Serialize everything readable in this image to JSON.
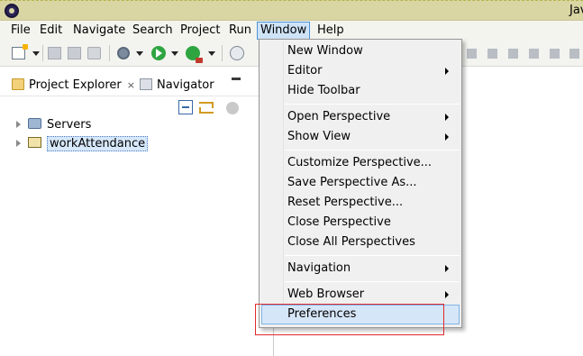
{
  "window": {
    "title": "Jav"
  },
  "menubar": {
    "items": [
      {
        "label": "File",
        "active": false
      },
      {
        "label": "Edit",
        "active": false
      },
      {
        "label": "Navigate",
        "active": false
      },
      {
        "label": "Search",
        "active": false
      },
      {
        "label": "Project",
        "active": false
      },
      {
        "label": "Run",
        "active": false
      },
      {
        "label": "Window",
        "active": true
      },
      {
        "label": "Help",
        "active": false
      }
    ]
  },
  "toolbar": {
    "icons": [
      "new-icon",
      "save-icon",
      "save-all-icon",
      "print-icon",
      "debug-icon",
      "run-icon",
      "external-tools-icon",
      "new-java-class-icon",
      "resume-icon",
      "suspend-icon",
      "terminate-icon",
      "disconnect-icon",
      "step-icon",
      "drop-to-frame-icon"
    ]
  },
  "views": {
    "tabs": [
      {
        "label": "Project Explorer",
        "icon": "folder-icon",
        "active": true,
        "close": "×"
      },
      {
        "label": "Navigator",
        "icon": "navigator-icon",
        "active": false
      }
    ],
    "tree": [
      {
        "label": "Servers",
        "icon": "server-folder-icon",
        "selected": false
      },
      {
        "label": "workAttendance",
        "icon": "java-project-icon",
        "selected": true
      }
    ]
  },
  "window_menu": {
    "groups": [
      [
        {
          "label": "New Window",
          "submenu": false
        },
        {
          "label": "Editor",
          "submenu": true
        },
        {
          "label": "Hide Toolbar",
          "submenu": false
        }
      ],
      [
        {
          "label": "Open Perspective",
          "submenu": true
        },
        {
          "label": "Show View",
          "submenu": true
        }
      ],
      [
        {
          "label": "Customize Perspective...",
          "submenu": false
        },
        {
          "label": "Save Perspective As...",
          "submenu": false
        },
        {
          "label": "Reset Perspective...",
          "submenu": false
        },
        {
          "label": "Close Perspective",
          "submenu": false
        },
        {
          "label": "Close All Perspectives",
          "submenu": false
        }
      ],
      [
        {
          "label": "Navigation",
          "submenu": true
        }
      ],
      [
        {
          "label": "Web Browser",
          "submenu": true
        },
        {
          "label": "Preferences",
          "submenu": false,
          "highlighted": true
        }
      ]
    ]
  },
  "annotation": {
    "color": "#e0292d"
  },
  "colors": {
    "titlebar": "#d9d6a4",
    "menu_highlight": "#cfe3f7",
    "selection": "#d7e8fb",
    "accent_border": "#4f93d8"
  }
}
